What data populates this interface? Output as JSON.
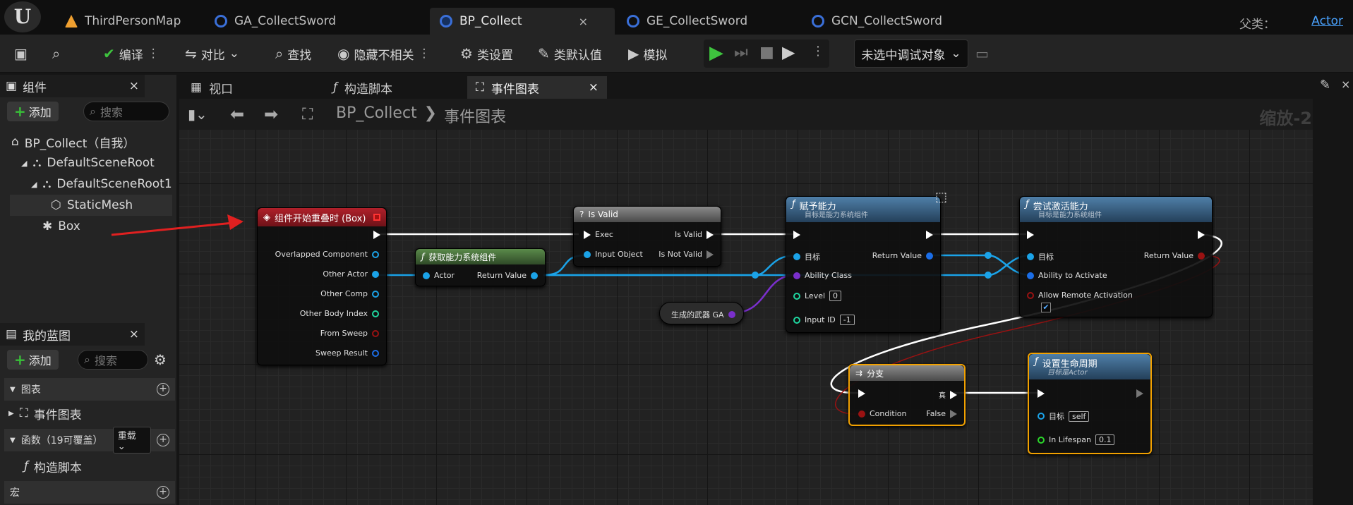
{
  "top_tabs": {
    "logo": "U",
    "tabs": [
      {
        "label": "ThirdPersonMap",
        "icon": "map-icon",
        "color": "#f0a030"
      },
      {
        "label": "GA_CollectSword",
        "icon": "gameplay-ability-icon",
        "color": "#3a6fd8"
      },
      {
        "label": "BP_Collect",
        "icon": "blueprint-icon",
        "color": "#3a6fd8"
      },
      {
        "label": "GE_CollectSword",
        "icon": "gameplay-effect-icon",
        "color": "#3a6fd8"
      },
      {
        "label": "GCN_CollectSword",
        "icon": "gameplay-cue-icon",
        "color": "#3a6fd8"
      }
    ],
    "close_glyph": "×",
    "parent_label": "父类：",
    "parent_value": "Actor"
  },
  "toolbar": {
    "compile": "编译",
    "diff": "对比",
    "find": "查找",
    "hide_unrelated": "隐藏不相关",
    "class_settings": "类设置",
    "class_defaults": "类默认值",
    "simulate": "模拟",
    "debug_select": "未选中调试对象"
  },
  "components_panel": {
    "title": "组件",
    "add": "添加",
    "search_placeholder": "搜索",
    "tree": [
      "BP_Collect（自我）",
      "DefaultSceneRoot",
      "DefaultSceneRoot1",
      "StaticMesh",
      "Box"
    ]
  },
  "my_blueprint": {
    "title": "我的蓝图",
    "add": "添加",
    "search_placeholder": "搜索",
    "graphs_section": "图表",
    "event_graph": "事件图表",
    "functions_section": "函数（19可覆盖）",
    "override": "重载",
    "construction_script": "构造脚本",
    "macros_section": "宏"
  },
  "graph_tabs": {
    "viewport": "视口",
    "construction": "构造脚本",
    "event_graph": "事件图表"
  },
  "graph": {
    "breadcrumb_bp": "BP_Collect",
    "breadcrumb_sep": "❯",
    "breadcrumb_graph": "事件图表",
    "zoom": "缩放-2"
  },
  "nodes": {
    "overlap": {
      "title": "组件开始重叠时 (Box)",
      "pins": [
        "Overlapped Component",
        "Other Actor",
        "Other Comp",
        "Other Body Index",
        "From Sweep",
        "Sweep Result"
      ]
    },
    "get_asc": {
      "title": "获取能力系统组件",
      "in": "Actor",
      "out": "Return Value"
    },
    "is_valid": {
      "title": "Is Valid",
      "exec": "Exec",
      "is_valid": "Is Valid",
      "input": "Input Object",
      "not_valid": "Is Not Valid"
    },
    "weapon_ga": {
      "label": "生成的武器 GA"
    },
    "give_ability": {
      "title": "赋予能力",
      "subtitle": "目标是能力系统组件",
      "target": "目标",
      "return": "Return Value",
      "ability_class": "Ability Class",
      "level": "Level",
      "level_val": "0",
      "input_id": "Input ID",
      "input_id_val": "-1"
    },
    "try_activate": {
      "title": "尝试激活能力",
      "subtitle": "目标是能力系统组件",
      "target": "目标",
      "return": "Return Value",
      "ability": "Ability to Activate",
      "allow_remote": "Allow Remote Activation",
      "allow_remote_checked": "✔"
    },
    "branch": {
      "title": "分支",
      "condition": "Condition",
      "false": "False",
      "true": "真"
    },
    "set_lifespan": {
      "title": "设置生命周期",
      "subtitle": "目标是Actor",
      "target": "目标",
      "target_val": "self",
      "lifespan": "In Lifespan",
      "lifespan_val": "0.1"
    }
  }
}
